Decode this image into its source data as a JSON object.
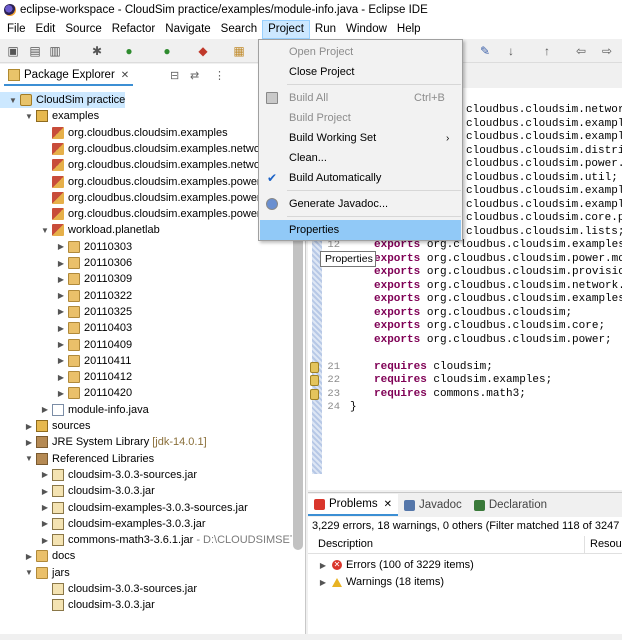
{
  "window": {
    "title": "eclipse-workspace - CloudSim practice/examples/module-info.java - Eclipse IDE"
  },
  "menubar": [
    "File",
    "Edit",
    "Source",
    "Refactor",
    "Navigate",
    "Search",
    "Project",
    "Run",
    "Window",
    "Help"
  ],
  "explorer": {
    "tab_label": "Package Explorer",
    "tree": [
      {
        "label": "CloudSim practice",
        "icon": "project-icon",
        "indent": 0,
        "expanded": true,
        "selected": true
      },
      {
        "label": "examples",
        "icon": "source-folder-icon",
        "indent": 1,
        "expanded": true
      },
      {
        "label": "org.cloudbus.cloudsim.examples",
        "icon": "package-icon",
        "indent": 2
      },
      {
        "label": "org.cloudbus.cloudsim.examples.network",
        "icon": "package-icon",
        "indent": 2
      },
      {
        "label": "org.cloudbus.cloudsim.examples.network",
        "icon": "package-icon",
        "indent": 2
      },
      {
        "label": "org.cloudbus.cloudsim.examples.power",
        "icon": "package-icon",
        "indent": 2
      },
      {
        "label": "org.cloudbus.cloudsim.examples.power",
        "icon": "package-icon",
        "indent": 2
      },
      {
        "label": "org.cloudbus.cloudsim.examples.power",
        "icon": "package-icon",
        "indent": 2
      },
      {
        "label": "workload.planetlab",
        "icon": "package-icon",
        "indent": 2,
        "expanded": true
      },
      {
        "label": "20110303",
        "icon": "folder-icon",
        "indent": 3,
        "collapsed": true
      },
      {
        "label": "20110306",
        "icon": "folder-icon",
        "indent": 3,
        "collapsed": true
      },
      {
        "label": "20110309",
        "icon": "folder-icon",
        "indent": 3,
        "collapsed": true
      },
      {
        "label": "20110322",
        "icon": "folder-icon",
        "indent": 3,
        "collapsed": true
      },
      {
        "label": "20110325",
        "icon": "folder-icon",
        "indent": 3,
        "collapsed": true
      },
      {
        "label": "20110403",
        "icon": "folder-icon",
        "indent": 3,
        "collapsed": true
      },
      {
        "label": "20110409",
        "icon": "folder-icon",
        "indent": 3,
        "collapsed": true
      },
      {
        "label": "20110411",
        "icon": "folder-icon",
        "indent": 3,
        "collapsed": true
      },
      {
        "label": "20110412",
        "icon": "folder-icon",
        "indent": 3,
        "collapsed": true
      },
      {
        "label": "20110420",
        "icon": "folder-icon",
        "indent": 3,
        "collapsed": true
      },
      {
        "label": "module-info.java",
        "icon": "java-file-icon",
        "indent": 2,
        "collapsed": true
      },
      {
        "label": "sources",
        "icon": "source-folder-icon",
        "indent": 1,
        "collapsed": true
      },
      {
        "label": "JRE System Library",
        "extra": "[jdk-14.0.1]",
        "icon": "library-icon",
        "indent": 1,
        "collapsed": true
      },
      {
        "label": "Referenced Libraries",
        "icon": "library-icon",
        "indent": 1,
        "expanded": true
      },
      {
        "label": "cloudsim-3.0.3-sources.jar",
        "icon": "jar-icon",
        "indent": 2,
        "collapsed": true
      },
      {
        "label": "cloudsim-3.0.3.jar",
        "icon": "jar-icon",
        "indent": 2,
        "collapsed": true
      },
      {
        "label": "cloudsim-examples-3.0.3-sources.jar",
        "icon": "jar-icon",
        "indent": 2,
        "collapsed": true
      },
      {
        "label": "cloudsim-examples-3.0.3.jar",
        "icon": "jar-icon",
        "indent": 2,
        "collapsed": true
      },
      {
        "label": "commons-math3-3.6.1.jar",
        "path": "- D:\\CLOUDSIMSETU",
        "icon": "jar-icon",
        "indent": 2,
        "collapsed": true
      },
      {
        "label": "docs",
        "icon": "folder-icon",
        "indent": 1,
        "collapsed": true
      },
      {
        "label": "jars",
        "icon": "folder-icon",
        "indent": 1,
        "expanded": true
      },
      {
        "label": "cloudsim-3.0.3-sources.jar",
        "icon": "jar-icon",
        "indent": 2
      },
      {
        "label": "cloudsim-3.0.3.jar",
        "icon": "jar-icon",
        "indent": 2
      }
    ]
  },
  "editor": {
    "lines": [
      {
        "n": "",
        "kw": "",
        "text": "cloudbus.cloudsim.network;"
      },
      {
        "n": "",
        "kw": "",
        "text": "cloudbus.cloudsim.examples.n"
      },
      {
        "n": "",
        "kw": "",
        "text": "cloudbus.cloudsim.examples.n"
      },
      {
        "n": "",
        "kw": "",
        "text": "cloudbus.cloudsim.distributi"
      },
      {
        "n": "",
        "kw": "",
        "text": "cloudbus.cloudsim.power.list"
      },
      {
        "n": "",
        "kw": "",
        "text": "cloudbus.cloudsim.util;"
      },
      {
        "n": "",
        "kw": "",
        "text": "cloudbus.cloudsim.examples;"
      },
      {
        "n": "",
        "kw": "",
        "text": "cloudbus.cloudsim.examples.p"
      },
      {
        "n": "",
        "kw": "",
        "text": "cloudbus.cloudsim.core.predi"
      },
      {
        "n": "",
        "kw": "",
        "text": "cloudbus.cloudsim.lists;"
      },
      {
        "n": "12",
        "kw": "exports",
        "text": " org.cloudbus.cloudsim.examples.p"
      },
      {
        "n": "",
        "kw": "exports",
        "text": " org.cloudbus.cloudsim.power.mode"
      },
      {
        "n": "",
        "kw": "exports",
        "text": " org.cloudbus.cloudsim.provisione"
      },
      {
        "n": "",
        "kw": "exports",
        "text": " org.cloudbus.cloudsim.network.da"
      },
      {
        "n": "",
        "kw": "exports",
        "text": " org.cloudbus.cloudsim.examples.p"
      },
      {
        "n": "",
        "kw": "exports",
        "text": " org.cloudbus.cloudsim;"
      },
      {
        "n": "",
        "kw": "exports",
        "text": " org.cloudbus.cloudsim.core;"
      },
      {
        "n": "",
        "kw": "exports",
        "text": " org.cloudbus.cloudsim.power;"
      },
      {
        "n": "",
        "kw": "",
        "text": ""
      },
      {
        "n": "21",
        "kw": "requires",
        "text": " cloudsim;"
      },
      {
        "n": "22",
        "kw": "requires",
        "text": " cloudsim.examples;"
      },
      {
        "n": "23",
        "kw": "requires",
        "text": " commons.math3;"
      },
      {
        "n": "24",
        "kw": "",
        "text": "}"
      }
    ]
  },
  "tooltip": "Properties",
  "project_menu": [
    {
      "label": "Open Project",
      "disabled": true,
      "sep_after": false
    },
    {
      "label": "Close Project",
      "disabled": false,
      "sep_after": true
    },
    {
      "label": "Build All",
      "accel": "Ctrl+B",
      "disabled": true,
      "icon": "build-all-icon"
    },
    {
      "label": "Build Project",
      "disabled": true
    },
    {
      "label": "Build Working Set",
      "submenu": true
    },
    {
      "label": "Clean..."
    },
    {
      "label": "Build Automatically",
      "checked": true,
      "sep_after": true
    },
    {
      "label": "Generate Javadoc...",
      "icon": "javadoc-icon",
      "sep_after": true
    },
    {
      "label": "Properties",
      "hover": true
    }
  ],
  "problems": {
    "tabs": [
      {
        "label": "Problems",
        "active": true,
        "icon": "problems-icon"
      },
      {
        "label": "Javadoc",
        "icon": "javadoc-icon"
      },
      {
        "label": "Declaration",
        "icon": "declaration-icon"
      }
    ],
    "summary": "3,229 errors, 18 warnings, 0 others (Filter matched 118 of 3247 iten",
    "columns": [
      "Description",
      "Resour"
    ],
    "rows": [
      {
        "label": "Errors (100 of 3229 items)",
        "type": "error"
      },
      {
        "label": "Warnings (18 items)",
        "type": "warning"
      }
    ]
  }
}
